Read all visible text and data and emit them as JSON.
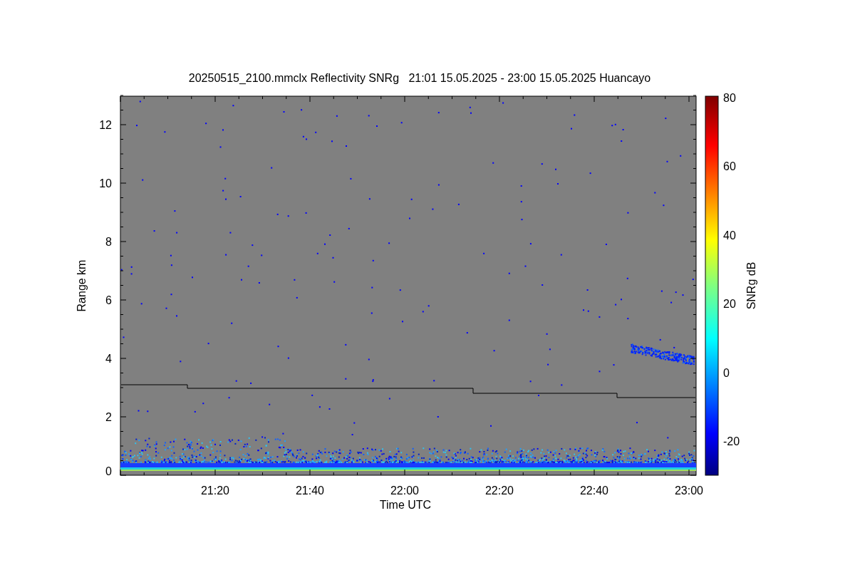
{
  "plot": {
    "title": "20250515_2100.mmclx Reflectivity SNRg   21:01 15.05.2025 - 23:00 15.05.2025 Huancayo",
    "xlabel": "Time UTC",
    "ylabel": "Range km",
    "xticks": [
      "21:20",
      "21:40",
      "22:00",
      "22:20",
      "22:40",
      "23:00"
    ],
    "yticks": [
      "12",
      "10",
      "8",
      "6",
      "4",
      "2",
      "0"
    ],
    "colorbar": {
      "label": "SNRg dB",
      "ticks": [
        "80",
        "60",
        "40",
        "20",
        "0",
        "-20"
      ]
    }
  }
}
